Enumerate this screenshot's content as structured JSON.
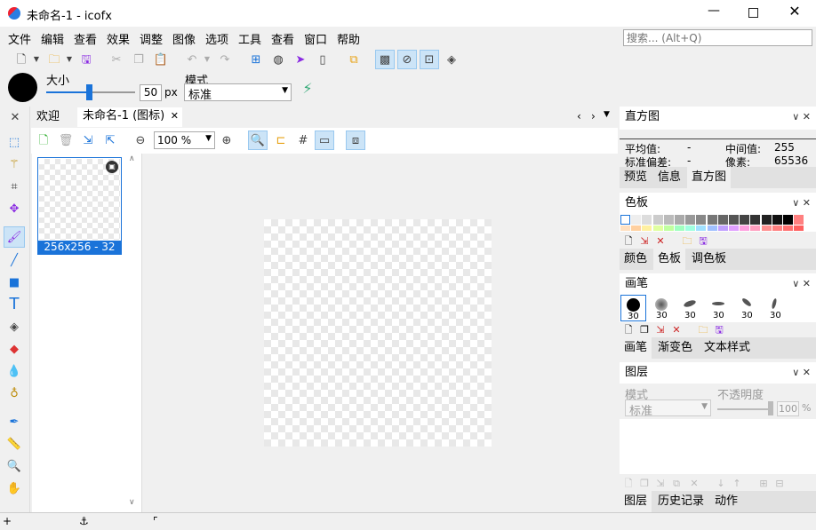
{
  "window": {
    "title": "未命名-1 - icofx"
  },
  "menu": [
    "文件",
    "编辑",
    "查看",
    "效果",
    "调整",
    "图像",
    "选项",
    "工具",
    "查看",
    "窗口",
    "帮助"
  ],
  "search": {
    "placeholder": "搜索... (Alt+Q)"
  },
  "options": {
    "size_label": "大小",
    "size_value": "50",
    "size_unit": "px",
    "size_level": 0.5,
    "mode_label": "模式",
    "mode_value": "标准"
  },
  "tabs": {
    "welcome": "欢迎",
    "doc": "未命名-1 (图标)"
  },
  "doc_toolbar": {
    "zoom": "100 %"
  },
  "thumb": {
    "label": "256x256 - 32"
  },
  "histogram": {
    "title": "直方图",
    "mean_label": "平均值:",
    "mean_value": "-",
    "median_label": "中间值:",
    "median_value": "255",
    "std_label": "标准偏差:",
    "std_value": "-",
    "pixels_label": "像素:",
    "pixels_value": "65536",
    "tabs": [
      "预览",
      "信息",
      "直方图"
    ]
  },
  "swatches_panel": {
    "title": "色板",
    "tabs": [
      "颜色",
      "色板",
      "调色板"
    ]
  },
  "brush_panel": {
    "title": "画笔",
    "sizes": [
      "30",
      "30",
      "30",
      "30",
      "30",
      "30"
    ],
    "tabs": [
      "画笔",
      "渐变色",
      "文本样式"
    ]
  },
  "layers_panel": {
    "title": "图层",
    "mode_label": "模式",
    "opacity_label": "不透明度",
    "mode_value": "标准",
    "opacity_value": "100",
    "opacity_unit": "%",
    "tabs": [
      "图层",
      "历史记录",
      "动作"
    ]
  },
  "colors": {
    "swatches_top": [
      "#ffffff",
      "#eeeeee",
      "#dddddd",
      "#cccccc",
      "#bbbbbb",
      "#aaaaaa",
      "#999999",
      "#888888",
      "#777777",
      "#666666",
      "#555555",
      "#444444",
      "#333333",
      "#222222",
      "#111111",
      "#000000",
      "#ff8080"
    ],
    "swatches_bottom": [
      "#ffe0c0",
      "#ffd0a0",
      "#fff0a0",
      "#e0ffa0",
      "#c0ffa0",
      "#a0ffc0",
      "#a0ffe0",
      "#a0e0ff",
      "#a0c0ff",
      "#c0a0ff",
      "#e0a0ff",
      "#ffa0e0",
      "#ffa0c0",
      "#ff9090",
      "#ff8080",
      "#ff7070",
      "#ff6060"
    ]
  }
}
